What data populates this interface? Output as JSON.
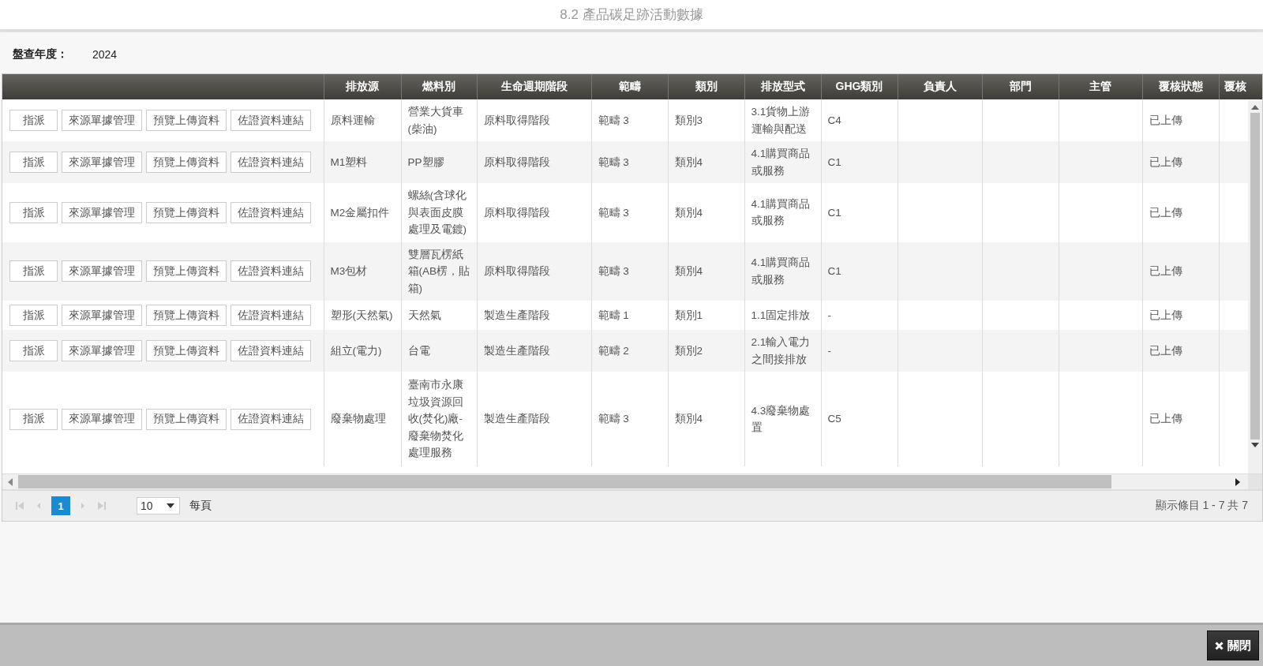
{
  "window": {
    "title": "8.2 產品碳足跡活動數據"
  },
  "filter": {
    "label": "盤查年度：",
    "value": "2024"
  },
  "table": {
    "columns": [
      {
        "label": "排放源"
      },
      {
        "label": "燃料別"
      },
      {
        "label": "生命週期階段"
      },
      {
        "label": "範疇"
      },
      {
        "label": "類別"
      },
      {
        "label": "排放型式"
      },
      {
        "label": "GHG類別"
      },
      {
        "label": "負責人"
      },
      {
        "label": "部門"
      },
      {
        "label": "主管"
      },
      {
        "label": "覆核狀態"
      },
      {
        "label": "覆核"
      }
    ],
    "rows": [
      {
        "actions": [
          "指派",
          "來源單據管理",
          "預覽上傳資料",
          "佐證資料連結"
        ],
        "source": "原料運輸",
        "fuel": "營業大貨車(柴油)",
        "stage": "原料取得階段",
        "scope": "範疇 3",
        "category": "類別3",
        "emission_type": "3.1貨物上游運輸與配送",
        "ghg_category": "C4",
        "review_status": "已上傳"
      },
      {
        "actions": [
          "指派",
          "來源單據管理",
          "預覽上傳資料",
          "佐證資料連結"
        ],
        "source": "M1塑料",
        "fuel": "PP塑膠",
        "stage": "原料取得階段",
        "scope": "範疇 3",
        "category": "類別4",
        "emission_type": "4.1購買商品或服務",
        "ghg_category": "C1",
        "review_status": "已上傳"
      },
      {
        "actions": [
          "指派",
          "來源單據管理",
          "預覽上傳資料",
          "佐證資料連結"
        ],
        "source": "M2金屬扣件",
        "fuel": "螺絲(含球化與表面皮膜處理及電鍍)",
        "stage": "原料取得階段",
        "scope": "範疇 3",
        "category": "類別4",
        "emission_type": "4.1購買商品或服務",
        "ghg_category": "C1",
        "review_status": "已上傳"
      },
      {
        "actions": [
          "指派",
          "來源單據管理",
          "預覽上傳資料",
          "佐證資料連結"
        ],
        "source": "M3包材",
        "fuel": "雙層瓦楞紙箱(AB楞，貼箱)",
        "stage": "原料取得階段",
        "scope": "範疇 3",
        "category": "類別4",
        "emission_type": "4.1購買商品或服務",
        "ghg_category": "C1",
        "review_status": "已上傳"
      },
      {
        "actions": [
          "指派",
          "來源單據管理",
          "預覽上傳資料",
          "佐證資料連結"
        ],
        "source": "塑形(天然氣)",
        "fuel": "天然氣",
        "stage": "製造生產階段",
        "scope": "範疇 1",
        "category": "類別1",
        "emission_type": "1.1固定排放",
        "ghg_category": "-",
        "review_status": "已上傳"
      },
      {
        "actions": [
          "指派",
          "來源單據管理",
          "預覽上傳資料",
          "佐證資料連結"
        ],
        "source": "組立(電力)",
        "fuel": "台電",
        "stage": "製造生產階段",
        "scope": "範疇 2",
        "category": "類別2",
        "emission_type": "2.1輸入電力之間接排放",
        "ghg_category": "-",
        "review_status": "已上傳"
      },
      {
        "actions": [
          "指派",
          "來源單據管理",
          "預覽上傳資料",
          "佐證資料連結"
        ],
        "source": "廢棄物處理",
        "fuel": "臺南市永康垃圾資源回收(焚化)廠-廢棄物焚化處理服務",
        "stage": "製造生產階段",
        "scope": "範疇 3",
        "category": "類別4",
        "emission_type": "4.3廢棄物處置",
        "ghg_category": "C5",
        "review_status": "已上傳"
      }
    ]
  },
  "pager": {
    "pages": [
      {
        "label": "1",
        "selected": true
      }
    ],
    "page_size": "10",
    "page_size_label": "每頁",
    "summary": "顯示條目 1 - 7 共 7"
  },
  "footer": {
    "close_button": "關閉"
  }
}
